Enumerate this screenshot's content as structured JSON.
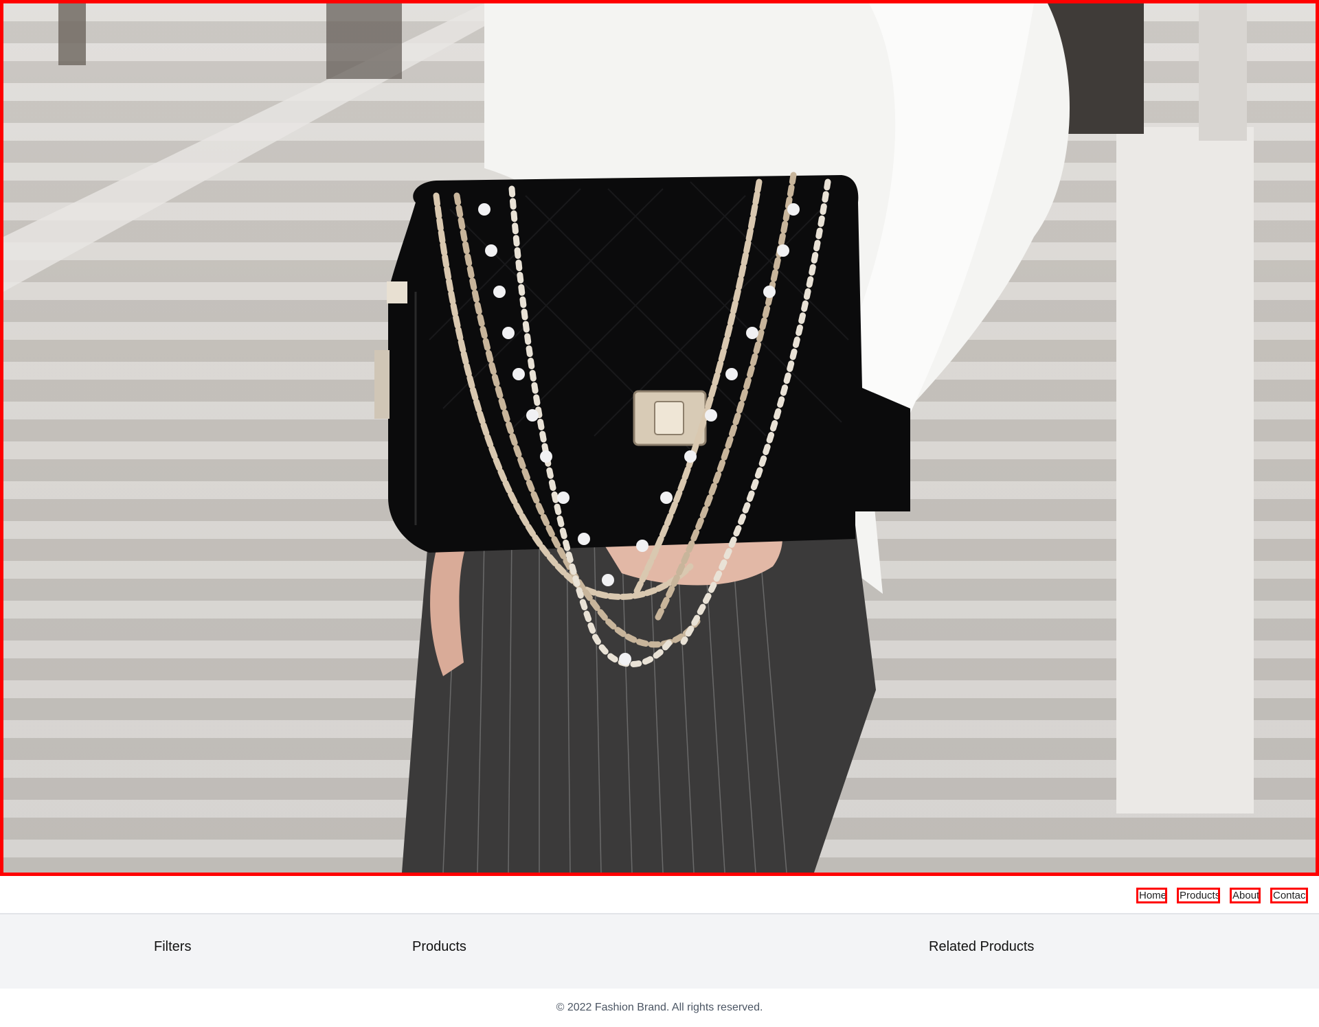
{
  "hero": {
    "image_alt": "Woman in white cable-knit sweater holding black quilted velvet handbag with pearl chain straps on stairs"
  },
  "nav": {
    "links": [
      {
        "label": "Home"
      },
      {
        "label": "Products"
      },
      {
        "label": "About"
      },
      {
        "label": "Contact"
      }
    ]
  },
  "main": {
    "filters_heading": "Filters",
    "products_heading": "Products",
    "related_heading": "Related Products"
  },
  "footer": {
    "copyright": "© 2022 Fashion Brand. All rights reserved."
  },
  "colors": {
    "highlight_border": "#ff0000",
    "main_background": "#f3f4f6",
    "footer_text": "#4b5563"
  }
}
